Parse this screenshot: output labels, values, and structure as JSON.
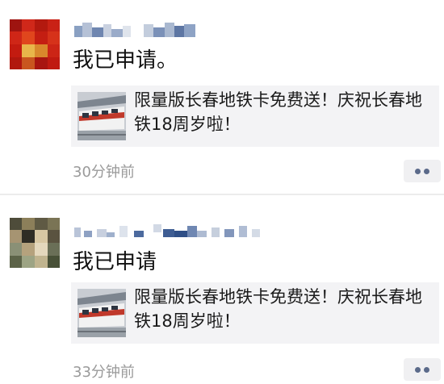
{
  "posts": [
    {
      "comment": "我已申请。",
      "share_card": {
        "title": "限量版长春地铁卡免费送！庆祝长春地铁18周岁啦！"
      },
      "time": "30分钟前"
    },
    {
      "comment": "我已申请",
      "share_card": {
        "title": "限量版长春地铁卡免费送！庆祝长春地铁18周岁啦！"
      },
      "time": "33分钟前"
    }
  ],
  "icons": {
    "more": "more-dots-icon"
  },
  "colors": {
    "more_dots": "#5b6a8a",
    "time_text": "#9a9a9a",
    "card_background": "#f3f3f5"
  }
}
